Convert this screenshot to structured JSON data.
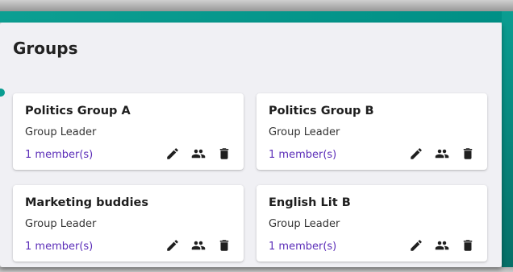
{
  "page": {
    "title": "Groups"
  },
  "colors": {
    "accent": "#0a9d91",
    "member_link": "#5b2db8",
    "panel_bg": "#f0f0f4"
  },
  "icons": [
    "edit-icon",
    "members-icon",
    "delete-icon"
  ],
  "groups": [
    {
      "name": "Politics Group A",
      "role": "Group Leader",
      "members": "1 member(s)"
    },
    {
      "name": "Politics Group B",
      "role": "Group Leader",
      "members": "1 member(s)"
    },
    {
      "name": "Marketing buddies",
      "role": "Group Leader",
      "members": "1 member(s)"
    },
    {
      "name": "English Lit B",
      "role": "Group Leader",
      "members": "1 member(s)"
    }
  ]
}
